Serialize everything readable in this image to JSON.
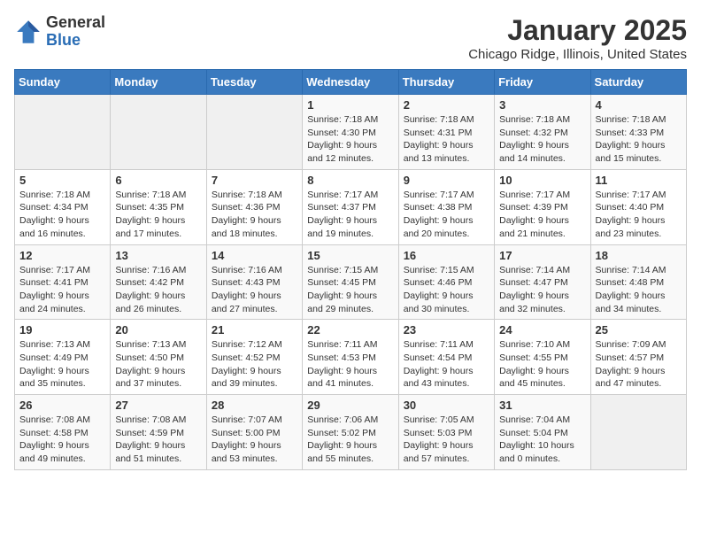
{
  "header": {
    "logo_general": "General",
    "logo_blue": "Blue",
    "title": "January 2025",
    "subtitle": "Chicago Ridge, Illinois, United States"
  },
  "weekdays": [
    "Sunday",
    "Monday",
    "Tuesday",
    "Wednesday",
    "Thursday",
    "Friday",
    "Saturday"
  ],
  "weeks": [
    [
      {
        "day": "",
        "info": ""
      },
      {
        "day": "",
        "info": ""
      },
      {
        "day": "",
        "info": ""
      },
      {
        "day": "1",
        "info": "Sunrise: 7:18 AM\nSunset: 4:30 PM\nDaylight: 9 hours\nand 12 minutes."
      },
      {
        "day": "2",
        "info": "Sunrise: 7:18 AM\nSunset: 4:31 PM\nDaylight: 9 hours\nand 13 minutes."
      },
      {
        "day": "3",
        "info": "Sunrise: 7:18 AM\nSunset: 4:32 PM\nDaylight: 9 hours\nand 14 minutes."
      },
      {
        "day": "4",
        "info": "Sunrise: 7:18 AM\nSunset: 4:33 PM\nDaylight: 9 hours\nand 15 minutes."
      }
    ],
    [
      {
        "day": "5",
        "info": "Sunrise: 7:18 AM\nSunset: 4:34 PM\nDaylight: 9 hours\nand 16 minutes."
      },
      {
        "day": "6",
        "info": "Sunrise: 7:18 AM\nSunset: 4:35 PM\nDaylight: 9 hours\nand 17 minutes."
      },
      {
        "day": "7",
        "info": "Sunrise: 7:18 AM\nSunset: 4:36 PM\nDaylight: 9 hours\nand 18 minutes."
      },
      {
        "day": "8",
        "info": "Sunrise: 7:17 AM\nSunset: 4:37 PM\nDaylight: 9 hours\nand 19 minutes."
      },
      {
        "day": "9",
        "info": "Sunrise: 7:17 AM\nSunset: 4:38 PM\nDaylight: 9 hours\nand 20 minutes."
      },
      {
        "day": "10",
        "info": "Sunrise: 7:17 AM\nSunset: 4:39 PM\nDaylight: 9 hours\nand 21 minutes."
      },
      {
        "day": "11",
        "info": "Sunrise: 7:17 AM\nSunset: 4:40 PM\nDaylight: 9 hours\nand 23 minutes."
      }
    ],
    [
      {
        "day": "12",
        "info": "Sunrise: 7:17 AM\nSunset: 4:41 PM\nDaylight: 9 hours\nand 24 minutes."
      },
      {
        "day": "13",
        "info": "Sunrise: 7:16 AM\nSunset: 4:42 PM\nDaylight: 9 hours\nand 26 minutes."
      },
      {
        "day": "14",
        "info": "Sunrise: 7:16 AM\nSunset: 4:43 PM\nDaylight: 9 hours\nand 27 minutes."
      },
      {
        "day": "15",
        "info": "Sunrise: 7:15 AM\nSunset: 4:45 PM\nDaylight: 9 hours\nand 29 minutes."
      },
      {
        "day": "16",
        "info": "Sunrise: 7:15 AM\nSunset: 4:46 PM\nDaylight: 9 hours\nand 30 minutes."
      },
      {
        "day": "17",
        "info": "Sunrise: 7:14 AM\nSunset: 4:47 PM\nDaylight: 9 hours\nand 32 minutes."
      },
      {
        "day": "18",
        "info": "Sunrise: 7:14 AM\nSunset: 4:48 PM\nDaylight: 9 hours\nand 34 minutes."
      }
    ],
    [
      {
        "day": "19",
        "info": "Sunrise: 7:13 AM\nSunset: 4:49 PM\nDaylight: 9 hours\nand 35 minutes."
      },
      {
        "day": "20",
        "info": "Sunrise: 7:13 AM\nSunset: 4:50 PM\nDaylight: 9 hours\nand 37 minutes."
      },
      {
        "day": "21",
        "info": "Sunrise: 7:12 AM\nSunset: 4:52 PM\nDaylight: 9 hours\nand 39 minutes."
      },
      {
        "day": "22",
        "info": "Sunrise: 7:11 AM\nSunset: 4:53 PM\nDaylight: 9 hours\nand 41 minutes."
      },
      {
        "day": "23",
        "info": "Sunrise: 7:11 AM\nSunset: 4:54 PM\nDaylight: 9 hours\nand 43 minutes."
      },
      {
        "day": "24",
        "info": "Sunrise: 7:10 AM\nSunset: 4:55 PM\nDaylight: 9 hours\nand 45 minutes."
      },
      {
        "day": "25",
        "info": "Sunrise: 7:09 AM\nSunset: 4:57 PM\nDaylight: 9 hours\nand 47 minutes."
      }
    ],
    [
      {
        "day": "26",
        "info": "Sunrise: 7:08 AM\nSunset: 4:58 PM\nDaylight: 9 hours\nand 49 minutes."
      },
      {
        "day": "27",
        "info": "Sunrise: 7:08 AM\nSunset: 4:59 PM\nDaylight: 9 hours\nand 51 minutes."
      },
      {
        "day": "28",
        "info": "Sunrise: 7:07 AM\nSunset: 5:00 PM\nDaylight: 9 hours\nand 53 minutes."
      },
      {
        "day": "29",
        "info": "Sunrise: 7:06 AM\nSunset: 5:02 PM\nDaylight: 9 hours\nand 55 minutes."
      },
      {
        "day": "30",
        "info": "Sunrise: 7:05 AM\nSunset: 5:03 PM\nDaylight: 9 hours\nand 57 minutes."
      },
      {
        "day": "31",
        "info": "Sunrise: 7:04 AM\nSunset: 5:04 PM\nDaylight: 10 hours\nand 0 minutes."
      },
      {
        "day": "",
        "info": ""
      }
    ]
  ]
}
